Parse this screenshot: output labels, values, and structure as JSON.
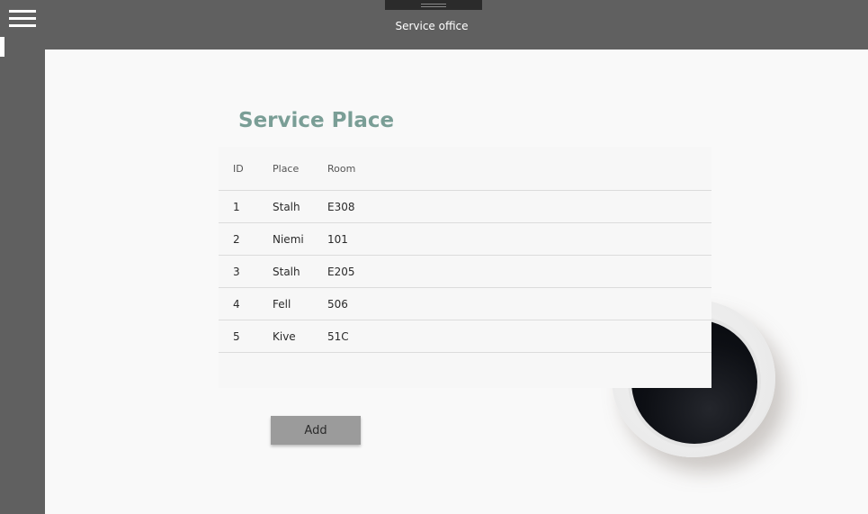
{
  "window": {
    "title": "Service office"
  },
  "page": {
    "title": "Service Place"
  },
  "table": {
    "headers": {
      "id": "ID",
      "place": "Place",
      "room": "Room"
    },
    "rows": [
      {
        "id": "1",
        "place": "Stalh",
        "room": "E308"
      },
      {
        "id": "2",
        "place": "Niemi",
        "room": "101"
      },
      {
        "id": "3",
        "place": "Stalh",
        "room": "E205"
      },
      {
        "id": "4",
        "place": "Fell",
        "room": "506"
      },
      {
        "id": "5",
        "place": "Kive",
        "room": "51C"
      }
    ]
  },
  "actions": {
    "add_label": "Add"
  },
  "icons": {
    "menu": "hamburger-menu-icon"
  },
  "colors": {
    "title_accent": "#7a9e96",
    "chrome": "#606060",
    "button": "#9b9b9b"
  }
}
